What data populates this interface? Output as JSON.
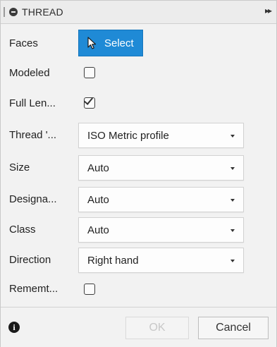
{
  "header": {
    "title": "THREAD",
    "expand_glyph": "▸▸"
  },
  "rows": {
    "faces": {
      "label": "Faces",
      "button_label": "Select"
    },
    "modeled": {
      "label": "Modeled",
      "checked": false
    },
    "full_length": {
      "label": "Full Len...",
      "checked": true
    },
    "thread_type": {
      "label": "Thread '...",
      "value": "ISO Metric profile"
    },
    "size": {
      "label": "Size",
      "value": "Auto"
    },
    "designation": {
      "label": "Designa...",
      "value": "Auto"
    },
    "class": {
      "label": "Class",
      "value": "Auto"
    },
    "direction": {
      "label": "Direction",
      "value": "Right hand"
    },
    "remember": {
      "label": "Rememt...",
      "checked": false
    }
  },
  "footer": {
    "ok_label": "OK",
    "cancel_label": "Cancel",
    "info_glyph": "i"
  },
  "colors": {
    "accent": "#1f8ad6",
    "panel": "#f2f2f2",
    "border": "#cfcfcf"
  },
  "icons": {
    "cursor": "arrow-cursor-icon",
    "info": "info-icon",
    "expand": "expand-icon",
    "collapse": "collapse-dot-icon"
  }
}
